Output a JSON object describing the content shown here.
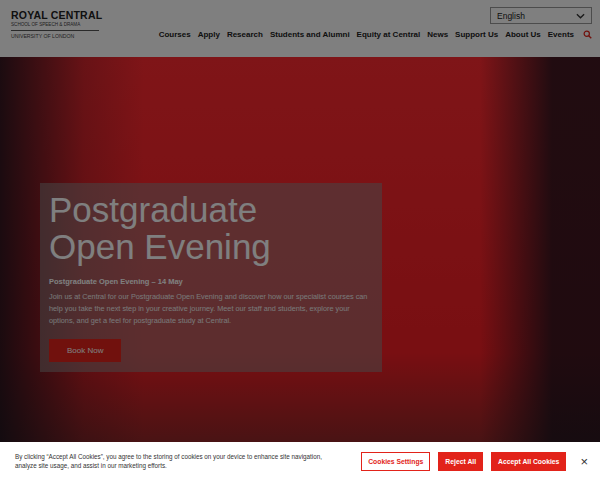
{
  "header": {
    "logo": {
      "name": "ROYAL CENTRAL",
      "subtitle": "SCHOOL OF SPEECH & DRAMA",
      "university": "UNIVERSITY OF LONDON"
    },
    "language": "English",
    "nav": [
      "Courses",
      "Apply",
      "Research",
      "Students and Alumni",
      "Equity at Central",
      "News",
      "Support Us",
      "About Us",
      "Events"
    ]
  },
  "hero": {
    "title": "Postgraduate Open Evening",
    "subtitle": "Postgraduate Open Evening – 14 May",
    "body": "Join us at Central for our Postgraduate Open Evening and discover how our specialist courses can help you take the next step in your creative journey. Meet our staff and students, explore your options, and get a feel for postgraduate study at Central.",
    "button": "Book Now"
  },
  "cookie_banner": {
    "text": "By clicking “Accept All Cookies”, you agree to the storing of cookies on your device to enhance site navigation, analyze site usage, and assist in our marketing efforts.",
    "buttons": [
      {
        "label": "Cookies Settings",
        "kind": "outline"
      },
      {
        "label": "Reject All",
        "kind": "filled"
      },
      {
        "label": "Accept All Cookies",
        "kind": "filled"
      }
    ],
    "close": "×"
  }
}
